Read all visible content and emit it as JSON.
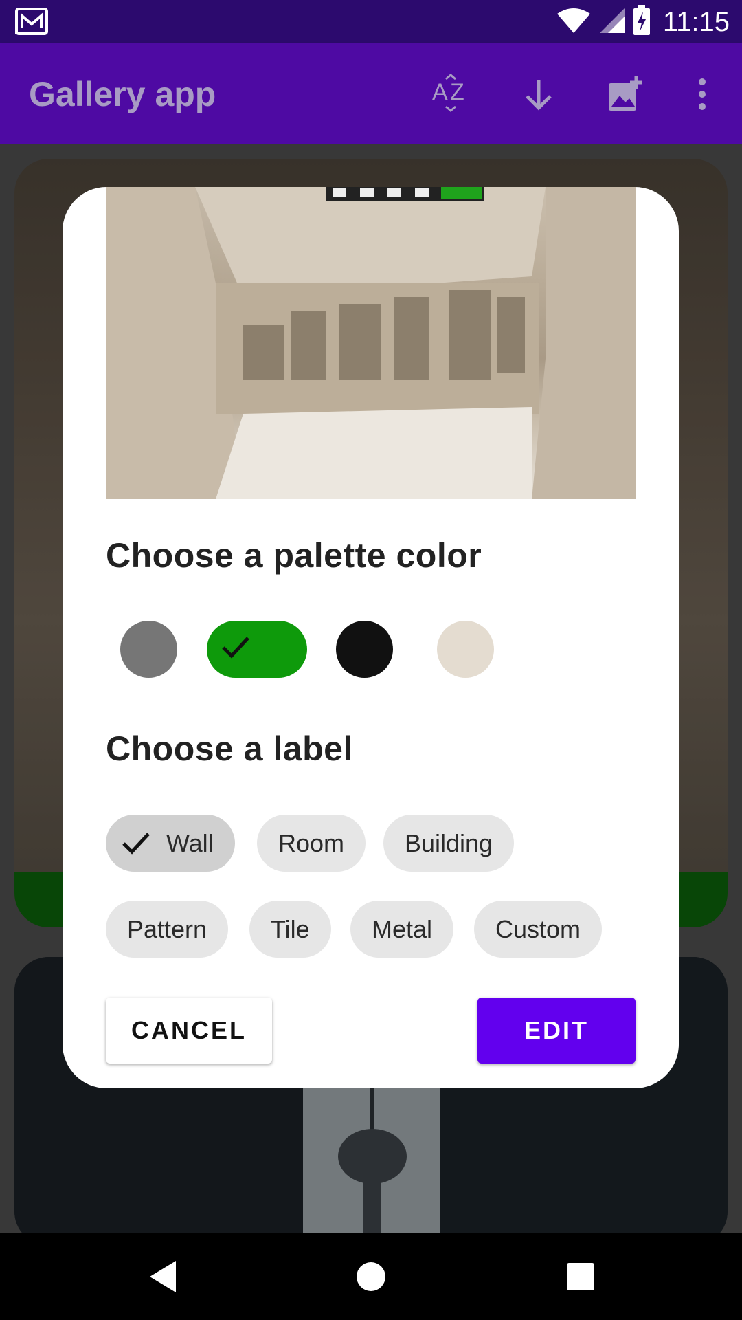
{
  "status_bar": {
    "time": "11:15",
    "icons": [
      "gmail-icon",
      "wifi-icon",
      "signal-icon",
      "battery-charging-icon"
    ]
  },
  "app_bar": {
    "title": "Gallery app",
    "actions": [
      "sort-az-icon",
      "download-icon",
      "add-photo-icon",
      "more-vert-icon"
    ]
  },
  "dialog": {
    "palette_title": "Choose a palette color",
    "palette": [
      {
        "color": "#767676",
        "selected": false
      },
      {
        "color": "#0e9a0b",
        "selected": true
      },
      {
        "color": "#111111",
        "selected": false
      },
      {
        "color": "#e4dcd0",
        "selected": false
      }
    ],
    "label_title": "Choose a label",
    "labels": [
      {
        "text": "Wall",
        "selected": true
      },
      {
        "text": "Room",
        "selected": false
      },
      {
        "text": "Building",
        "selected": false
      },
      {
        "text": "Pattern",
        "selected": false
      },
      {
        "text": "Tile",
        "selected": false
      },
      {
        "text": "Metal",
        "selected": false
      },
      {
        "text": "Custom",
        "selected": false
      }
    ],
    "cancel_label": "CANCEL",
    "edit_label": "EDIT",
    "accent_color": "#6200ee"
  },
  "nav_bar": {
    "buttons": [
      "back-icon",
      "home-icon",
      "recents-icon"
    ]
  }
}
